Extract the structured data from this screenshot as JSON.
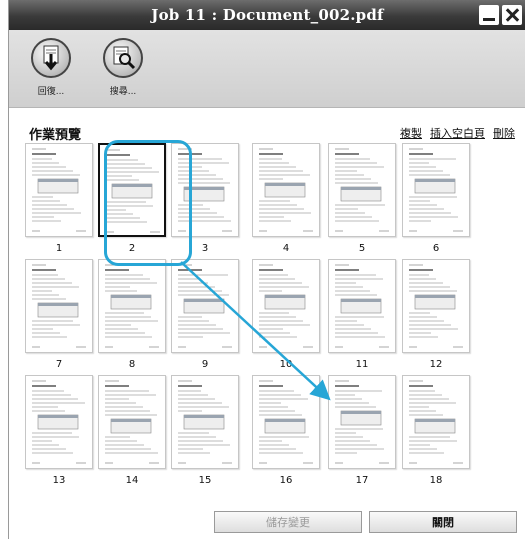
{
  "window": {
    "title": "Job 11 : Document_002.pdf"
  },
  "toolbar": {
    "items": [
      {
        "label": "回復...",
        "icon": "download-restore-icon"
      },
      {
        "label": "搜尋...",
        "icon": "search-document-icon"
      }
    ]
  },
  "preview": {
    "heading": "作業預覽",
    "actions": [
      "複製",
      "插入空白頁",
      "刪除"
    ]
  },
  "pages": [
    {
      "num": "1"
    },
    {
      "num": "2",
      "selected": true
    },
    {
      "num": "3"
    },
    {
      "num": "4"
    },
    {
      "num": "5"
    },
    {
      "num": "6"
    },
    {
      "num": "7"
    },
    {
      "num": "8"
    },
    {
      "num": "9"
    },
    {
      "num": "10"
    },
    {
      "num": "11"
    },
    {
      "num": "12"
    },
    {
      "num": "13"
    },
    {
      "num": "14"
    },
    {
      "num": "15"
    },
    {
      "num": "16"
    },
    {
      "num": "17"
    },
    {
      "num": "18"
    }
  ],
  "footer": {
    "save_label": "儲存變更",
    "close_label": "關閉"
  },
  "colors": {
    "highlight": "#27a6d6",
    "titlebar": "#3a3a3a"
  }
}
